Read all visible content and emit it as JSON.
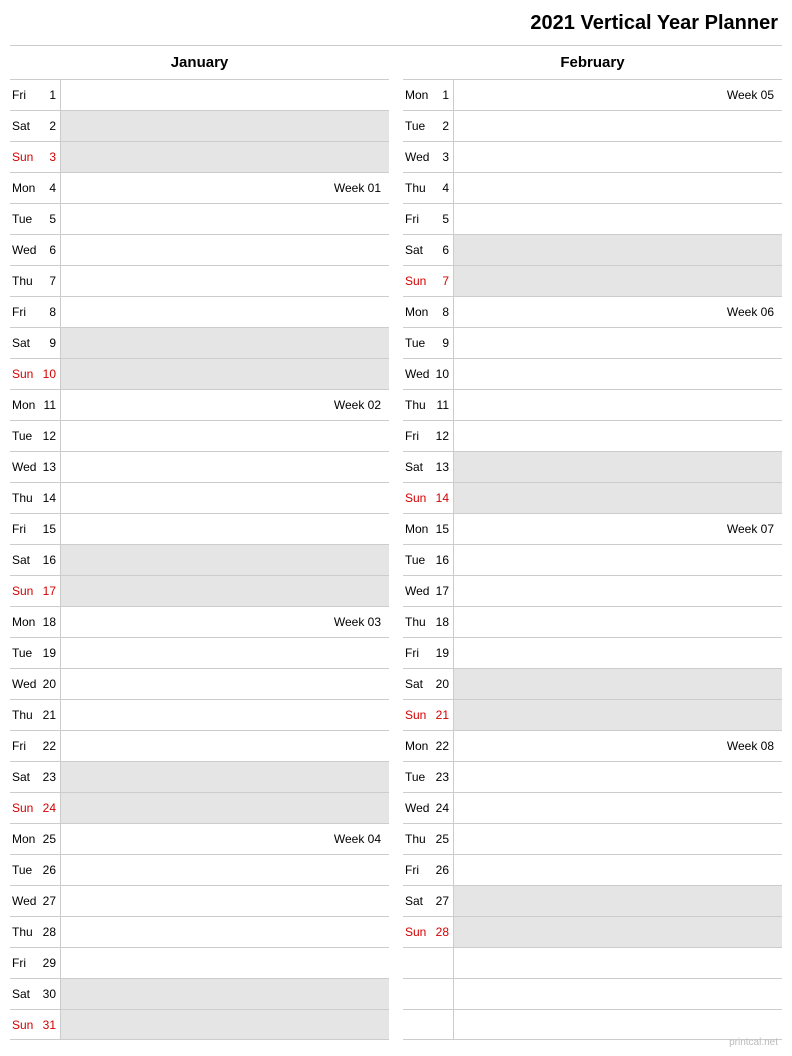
{
  "title": "2021 Vertical Year Planner",
  "footer": "printcal.net",
  "months": [
    {
      "name": "January",
      "days": [
        {
          "dow": "Fri",
          "num": 1,
          "weekend": false,
          "sunday": false,
          "note": ""
        },
        {
          "dow": "Sat",
          "num": 2,
          "weekend": true,
          "sunday": false,
          "note": ""
        },
        {
          "dow": "Sun",
          "num": 3,
          "weekend": true,
          "sunday": true,
          "note": ""
        },
        {
          "dow": "Mon",
          "num": 4,
          "weekend": false,
          "sunday": false,
          "note": "Week 01"
        },
        {
          "dow": "Tue",
          "num": 5,
          "weekend": false,
          "sunday": false,
          "note": ""
        },
        {
          "dow": "Wed",
          "num": 6,
          "weekend": false,
          "sunday": false,
          "note": ""
        },
        {
          "dow": "Thu",
          "num": 7,
          "weekend": false,
          "sunday": false,
          "note": ""
        },
        {
          "dow": "Fri",
          "num": 8,
          "weekend": false,
          "sunday": false,
          "note": ""
        },
        {
          "dow": "Sat",
          "num": 9,
          "weekend": true,
          "sunday": false,
          "note": ""
        },
        {
          "dow": "Sun",
          "num": 10,
          "weekend": true,
          "sunday": true,
          "note": ""
        },
        {
          "dow": "Mon",
          "num": 11,
          "weekend": false,
          "sunday": false,
          "note": "Week 02"
        },
        {
          "dow": "Tue",
          "num": 12,
          "weekend": false,
          "sunday": false,
          "note": ""
        },
        {
          "dow": "Wed",
          "num": 13,
          "weekend": false,
          "sunday": false,
          "note": ""
        },
        {
          "dow": "Thu",
          "num": 14,
          "weekend": false,
          "sunday": false,
          "note": ""
        },
        {
          "dow": "Fri",
          "num": 15,
          "weekend": false,
          "sunday": false,
          "note": ""
        },
        {
          "dow": "Sat",
          "num": 16,
          "weekend": true,
          "sunday": false,
          "note": ""
        },
        {
          "dow": "Sun",
          "num": 17,
          "weekend": true,
          "sunday": true,
          "note": ""
        },
        {
          "dow": "Mon",
          "num": 18,
          "weekend": false,
          "sunday": false,
          "note": "Week 03"
        },
        {
          "dow": "Tue",
          "num": 19,
          "weekend": false,
          "sunday": false,
          "note": ""
        },
        {
          "dow": "Wed",
          "num": 20,
          "weekend": false,
          "sunday": false,
          "note": ""
        },
        {
          "dow": "Thu",
          "num": 21,
          "weekend": false,
          "sunday": false,
          "note": ""
        },
        {
          "dow": "Fri",
          "num": 22,
          "weekend": false,
          "sunday": false,
          "note": ""
        },
        {
          "dow": "Sat",
          "num": 23,
          "weekend": true,
          "sunday": false,
          "note": ""
        },
        {
          "dow": "Sun",
          "num": 24,
          "weekend": true,
          "sunday": true,
          "note": ""
        },
        {
          "dow": "Mon",
          "num": 25,
          "weekend": false,
          "sunday": false,
          "note": "Week 04"
        },
        {
          "dow": "Tue",
          "num": 26,
          "weekend": false,
          "sunday": false,
          "note": ""
        },
        {
          "dow": "Wed",
          "num": 27,
          "weekend": false,
          "sunday": false,
          "note": ""
        },
        {
          "dow": "Thu",
          "num": 28,
          "weekend": false,
          "sunday": false,
          "note": ""
        },
        {
          "dow": "Fri",
          "num": 29,
          "weekend": false,
          "sunday": false,
          "note": ""
        },
        {
          "dow": "Sat",
          "num": 30,
          "weekend": true,
          "sunday": false,
          "note": ""
        },
        {
          "dow": "Sun",
          "num": 31,
          "weekend": true,
          "sunday": true,
          "note": ""
        }
      ]
    },
    {
      "name": "February",
      "days": [
        {
          "dow": "Mon",
          "num": 1,
          "weekend": false,
          "sunday": false,
          "note": "Week 05"
        },
        {
          "dow": "Tue",
          "num": 2,
          "weekend": false,
          "sunday": false,
          "note": ""
        },
        {
          "dow": "Wed",
          "num": 3,
          "weekend": false,
          "sunday": false,
          "note": ""
        },
        {
          "dow": "Thu",
          "num": 4,
          "weekend": false,
          "sunday": false,
          "note": ""
        },
        {
          "dow": "Fri",
          "num": 5,
          "weekend": false,
          "sunday": false,
          "note": ""
        },
        {
          "dow": "Sat",
          "num": 6,
          "weekend": true,
          "sunday": false,
          "note": ""
        },
        {
          "dow": "Sun",
          "num": 7,
          "weekend": true,
          "sunday": true,
          "note": ""
        },
        {
          "dow": "Mon",
          "num": 8,
          "weekend": false,
          "sunday": false,
          "note": "Week 06"
        },
        {
          "dow": "Tue",
          "num": 9,
          "weekend": false,
          "sunday": false,
          "note": ""
        },
        {
          "dow": "Wed",
          "num": 10,
          "weekend": false,
          "sunday": false,
          "note": ""
        },
        {
          "dow": "Thu",
          "num": 11,
          "weekend": false,
          "sunday": false,
          "note": ""
        },
        {
          "dow": "Fri",
          "num": 12,
          "weekend": false,
          "sunday": false,
          "note": ""
        },
        {
          "dow": "Sat",
          "num": 13,
          "weekend": true,
          "sunday": false,
          "note": ""
        },
        {
          "dow": "Sun",
          "num": 14,
          "weekend": true,
          "sunday": true,
          "note": ""
        },
        {
          "dow": "Mon",
          "num": 15,
          "weekend": false,
          "sunday": false,
          "note": "Week 07"
        },
        {
          "dow": "Tue",
          "num": 16,
          "weekend": false,
          "sunday": false,
          "note": ""
        },
        {
          "dow": "Wed",
          "num": 17,
          "weekend": false,
          "sunday": false,
          "note": ""
        },
        {
          "dow": "Thu",
          "num": 18,
          "weekend": false,
          "sunday": false,
          "note": ""
        },
        {
          "dow": "Fri",
          "num": 19,
          "weekend": false,
          "sunday": false,
          "note": ""
        },
        {
          "dow": "Sat",
          "num": 20,
          "weekend": true,
          "sunday": false,
          "note": ""
        },
        {
          "dow": "Sun",
          "num": 21,
          "weekend": true,
          "sunday": true,
          "note": ""
        },
        {
          "dow": "Mon",
          "num": 22,
          "weekend": false,
          "sunday": false,
          "note": "Week 08"
        },
        {
          "dow": "Tue",
          "num": 23,
          "weekend": false,
          "sunday": false,
          "note": ""
        },
        {
          "dow": "Wed",
          "num": 24,
          "weekend": false,
          "sunday": false,
          "note": ""
        },
        {
          "dow": "Thu",
          "num": 25,
          "weekend": false,
          "sunday": false,
          "note": ""
        },
        {
          "dow": "Fri",
          "num": 26,
          "weekend": false,
          "sunday": false,
          "note": ""
        },
        {
          "dow": "Sat",
          "num": 27,
          "weekend": true,
          "sunday": false,
          "note": ""
        },
        {
          "dow": "Sun",
          "num": 28,
          "weekend": true,
          "sunday": true,
          "note": ""
        },
        {
          "dow": "",
          "num": "",
          "weekend": false,
          "sunday": false,
          "note": ""
        },
        {
          "dow": "",
          "num": "",
          "weekend": false,
          "sunday": false,
          "note": ""
        },
        {
          "dow": "",
          "num": "",
          "weekend": false,
          "sunday": false,
          "note": ""
        }
      ]
    }
  ]
}
